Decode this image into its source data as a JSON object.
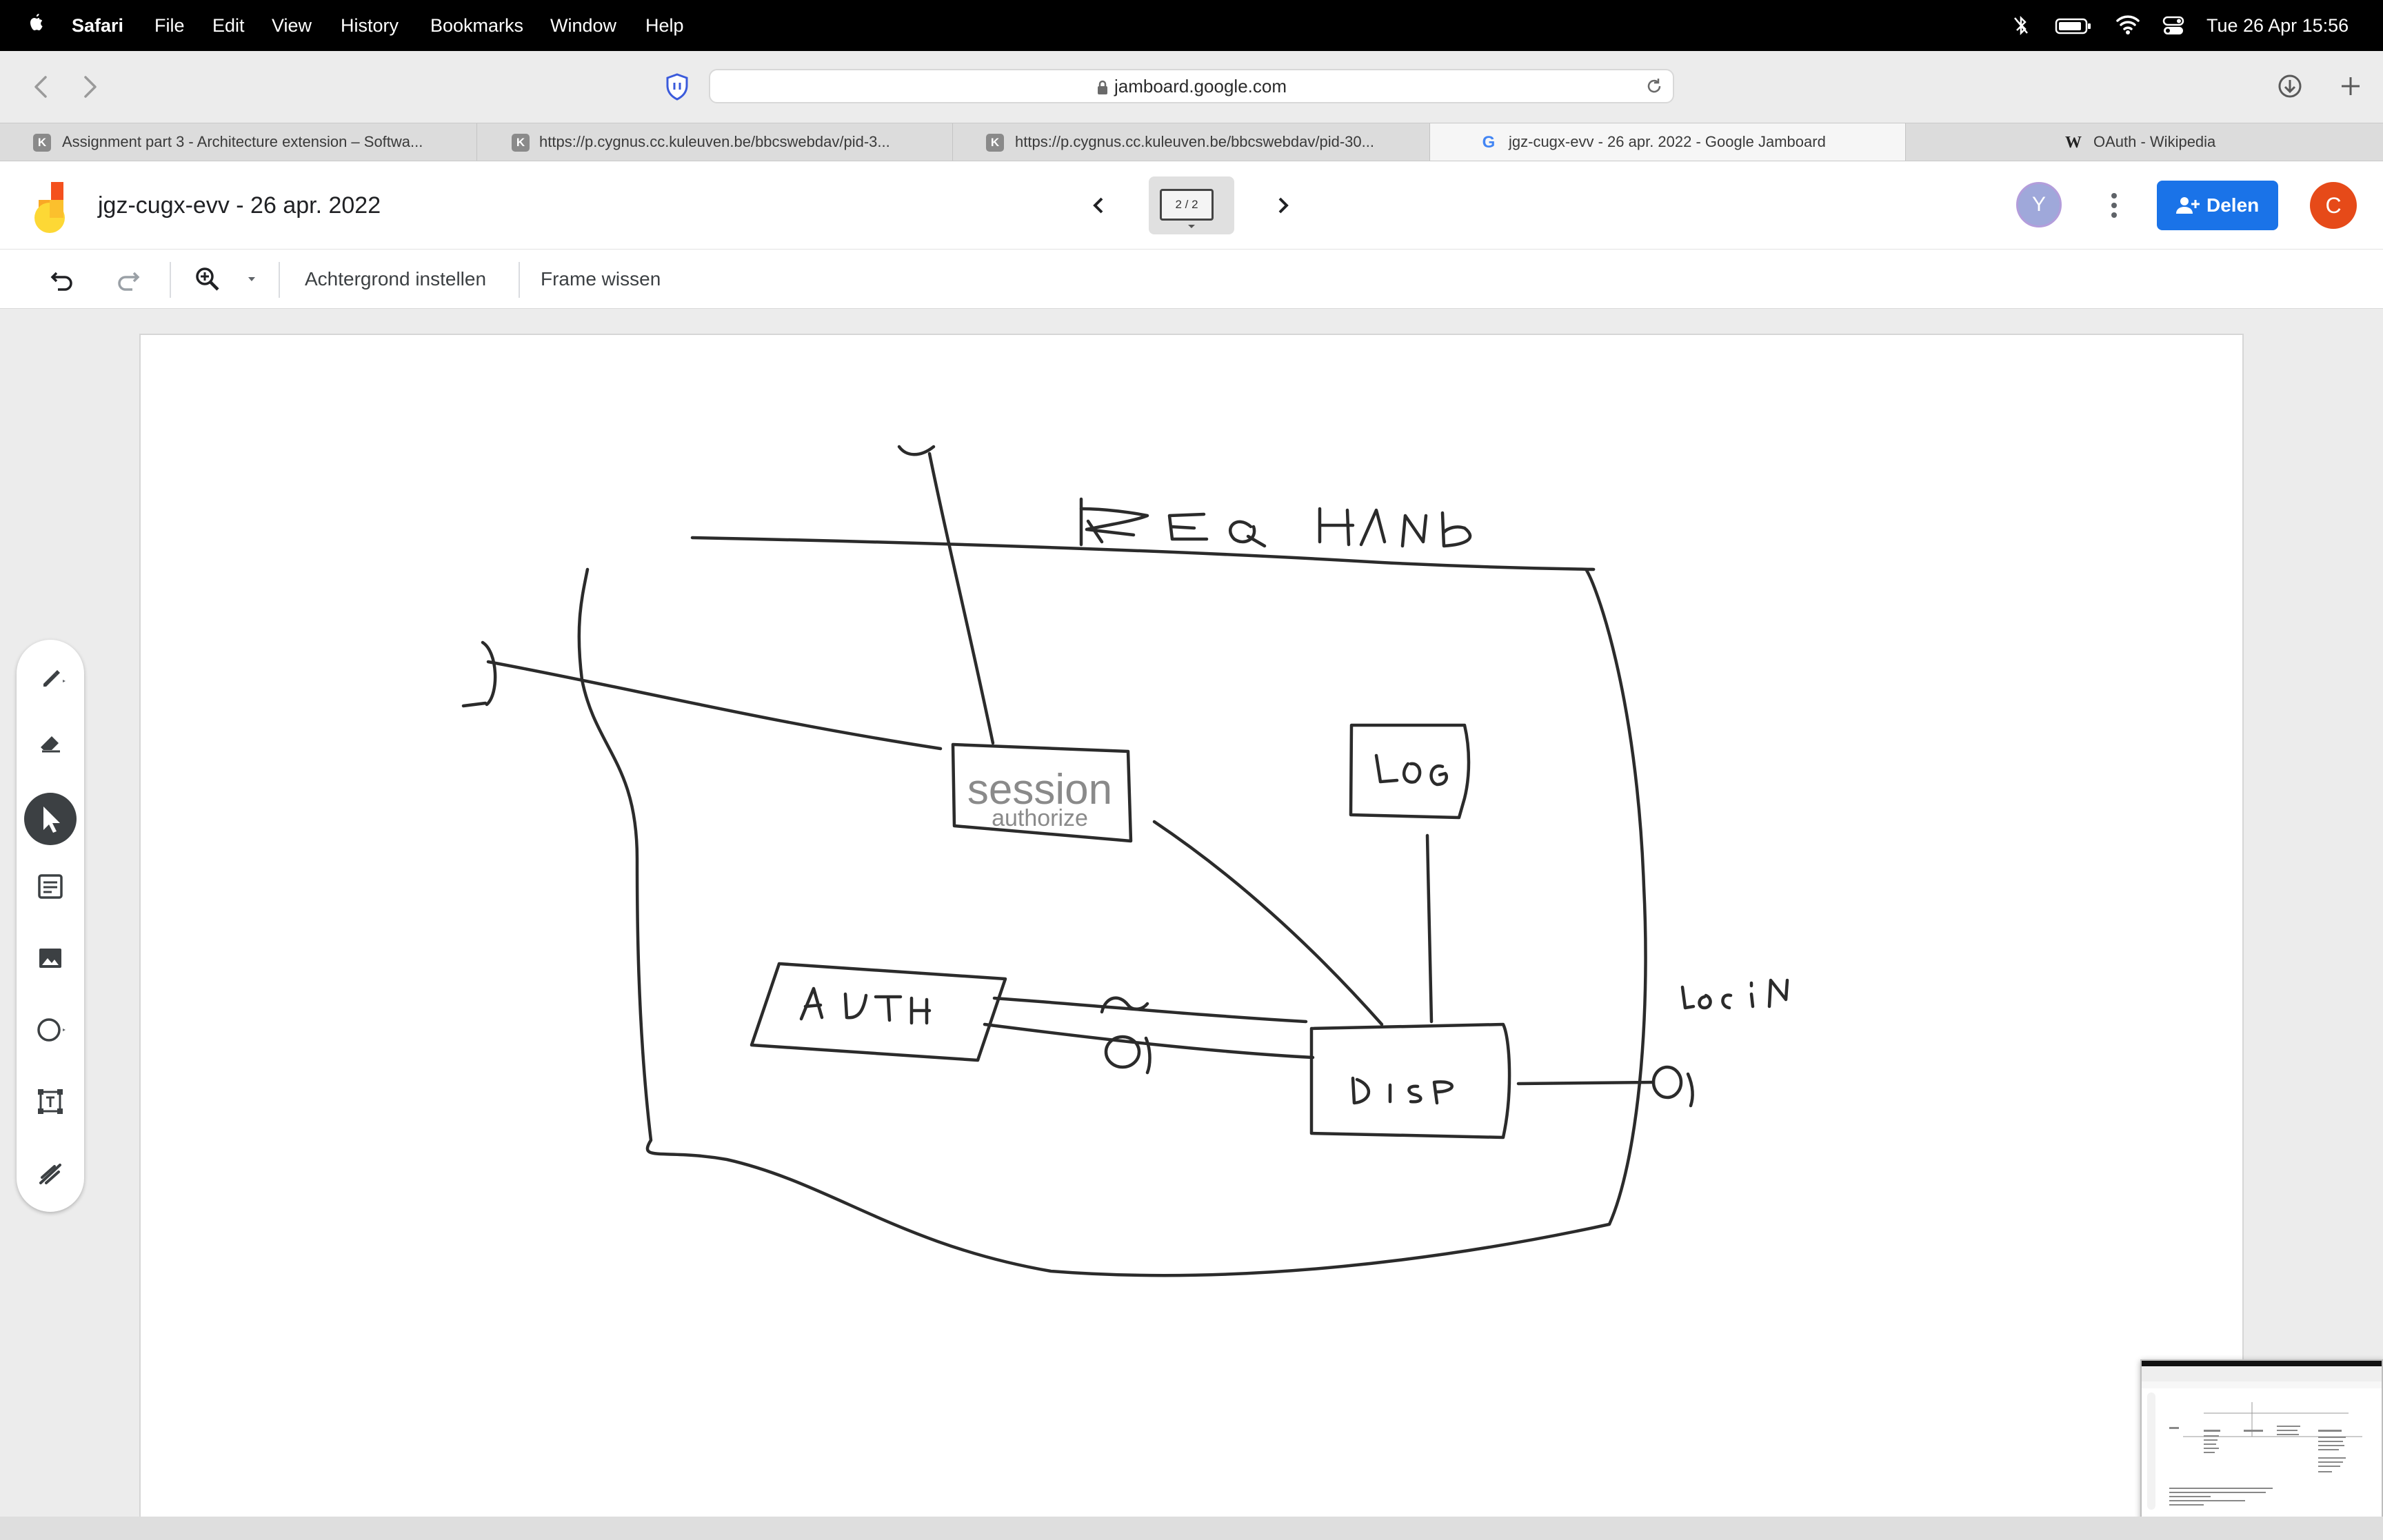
{
  "menubar": {
    "app": "Safari",
    "items": [
      "File",
      "Edit",
      "View",
      "History",
      "Bookmarks",
      "Window",
      "Help"
    ],
    "datetime": "Tue 26 Apr  15:56"
  },
  "browser": {
    "url": "jamboard.google.com",
    "tabs": [
      {
        "label": "Assignment part 3 - Architecture extension – Softwa...",
        "favicon": "K"
      },
      {
        "label": "https://p.cygnus.cc.kuleuven.be/bbcswebdav/pid-3...",
        "favicon": "K"
      },
      {
        "label": "https://p.cygnus.cc.kuleuven.be/bbcswebdav/pid-30...",
        "favicon": "K"
      },
      {
        "label": "jgz-cugx-evv - 26 apr. 2022 - Google Jamboard",
        "favicon": "G"
      },
      {
        "label": "OAuth - Wikipedia",
        "favicon": "W"
      }
    ],
    "active_tab": 3
  },
  "jamboard": {
    "title": "jgz-cugx-evv - 26 apr. 2022",
    "frame_indicator": "2 / 2",
    "share_label": "Delen",
    "avatar_viewer": "Y",
    "avatar_user": "C",
    "toolbar": {
      "background_label": "Achtergrond instellen",
      "clear_label": "Frame wissen"
    },
    "colors": {
      "share_blue": "#1a73e8",
      "avatar_orange": "#e64a19",
      "avatar_lavender": "#9fa8da"
    }
  },
  "drawing": {
    "text_box_main": "session",
    "text_box_sub": "authorize",
    "handwritten": [
      "REQ HAND",
      "LOG",
      "AUTH",
      "DISP",
      "LOGIN"
    ]
  },
  "icons": [
    "apple-icon",
    "control-center-icon",
    "wifi-icon",
    "battery-icon",
    "bluetooth-icon",
    "back-icon",
    "forward-icon",
    "shield-icon",
    "lock-icon",
    "reload-icon",
    "download-icon",
    "new-tab-icon",
    "jamboard-logo",
    "undo-icon",
    "redo-icon",
    "zoom-icon",
    "pen-icon",
    "eraser-icon",
    "select-icon",
    "sticky-note-icon",
    "image-icon",
    "circle-icon",
    "text-box-icon",
    "laser-icon",
    "more-vert-icon",
    "person-add-icon"
  ]
}
